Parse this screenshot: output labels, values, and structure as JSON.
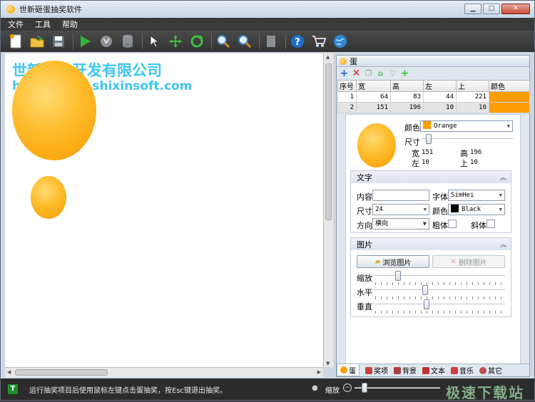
{
  "window": {
    "title": "世新砸蛋抽奖软件",
    "controls": [
      "minimize",
      "maximize",
      "close"
    ]
  },
  "menu": [
    "文件",
    "工具",
    "帮助"
  ],
  "toolbar": [
    "new-file-icon",
    "open-folder-icon",
    "save-icon",
    "play-icon",
    "filter-icon",
    "database-icon",
    "pointer-icon",
    "move-icon",
    "rotate-icon",
    "zoom-in-icon",
    "zoom-out-icon",
    "document-icon",
    "help-icon",
    "cart-icon",
    "globe-icon"
  ],
  "canvas": {
    "company": "世新软件开发有限公司",
    "url": "http://www.shixinsoft.com",
    "egg_color": "#ffb020"
  },
  "panel": {
    "title": "蛋",
    "tools": [
      "add-icon",
      "delete-icon",
      "copy-icon",
      "move-top-icon",
      "move-bottom-icon",
      "add-green-icon"
    ],
    "table": {
      "columns": [
        "序号",
        "宽",
        "高",
        "左",
        "上",
        "颜色"
      ],
      "rows": [
        {
          "index": "1",
          "width": "64",
          "height": "83",
          "left": "44",
          "top": "221",
          "color": "#ff9e00"
        },
        {
          "index": "2",
          "width": "151",
          "height": "196",
          "left": "10",
          "top": "10",
          "color": "#ff9e00"
        }
      ]
    },
    "egg": {
      "color_label": "颜色",
      "color_value": "Orange",
      "size_label": "尺寸",
      "size_percent": 10,
      "width_label": "宽",
      "width_value": "151",
      "height_label": "高",
      "height_value": "196",
      "left_label": "左",
      "left_value": "10",
      "top_label": "上",
      "top_value": "10"
    },
    "text_section": {
      "title": "文字",
      "content_label": "内容",
      "content_value": "",
      "font_label": "字体",
      "font_value": "SimHei",
      "size_label": "尺寸",
      "size_value": "24",
      "color_label": "颜色",
      "color_value": "Black",
      "direction_label": "方向",
      "direction_value": "横向",
      "bold_label": "粗体",
      "italic_label": "斜体"
    },
    "image_section": {
      "title": "图片",
      "browse_label": "浏览图片",
      "delete_label": "删除图片",
      "scale_label": "缩放",
      "horizontal_label": "水平",
      "vertical_label": "垂直"
    },
    "tabs": [
      "蛋",
      "奖项",
      "背景",
      "文本",
      "音乐",
      "其它"
    ]
  },
  "status": {
    "text": "运行抽奖项目后使用鼠标左键点击蛋抽奖，按Esc键退出抽奖。",
    "zoom_label": "缩放",
    "watermark": "极速下载站"
  }
}
